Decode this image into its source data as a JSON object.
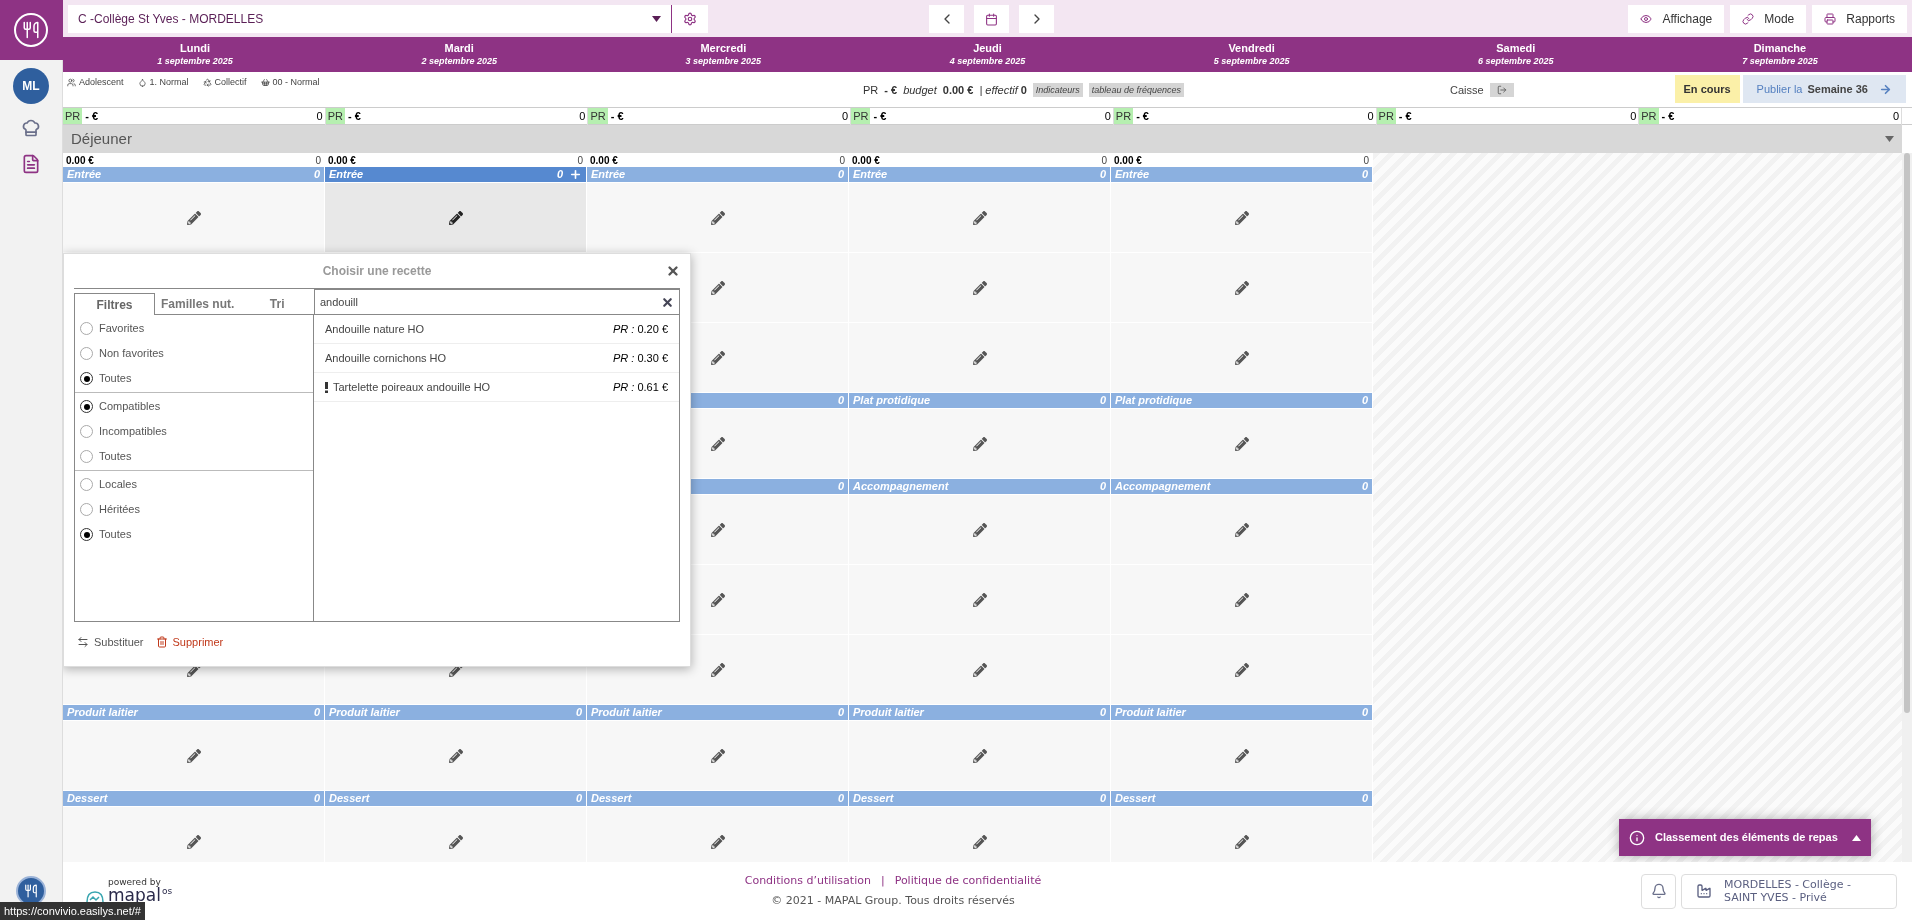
{
  "sidebar": {
    "avatar": "ML"
  },
  "toolbar": {
    "site_select": "C -Collège St Yves - MORDELLES",
    "buttons": [
      {
        "label": "Affichage",
        "kind": "eye"
      },
      {
        "label": "Mode",
        "kind": "link"
      },
      {
        "label": "Rapports",
        "kind": "printer"
      }
    ]
  },
  "days": [
    {
      "name": "Lundi",
      "date": "1 septembre 2025"
    },
    {
      "name": "Mardi",
      "date": "2 septembre 2025"
    },
    {
      "name": "Mercredi",
      "date": "3 septembre 2025"
    },
    {
      "name": "Jeudi",
      "date": "4 septembre 2025"
    },
    {
      "name": "Vendredi",
      "date": "5 septembre 2025"
    },
    {
      "name": "Samedi",
      "date": "6 septembre 2025"
    },
    {
      "name": "Dimanche",
      "date": "7 septembre 2025"
    }
  ],
  "info": {
    "tags": [
      {
        "label": "Adolescent",
        "kind": "people"
      },
      {
        "label": "1. Normal",
        "kind": "drop"
      },
      {
        "label": "Collectif",
        "kind": "recycle"
      },
      {
        "label": "00 - Normal",
        "kind": "basket"
      }
    ],
    "pr_label": "PR",
    "pr_value": "- €",
    "budget_label": "budget",
    "budget_value": "0.00 €",
    "effectif_label": "| effectif",
    "effectif_value": "0",
    "chips": [
      "Indicateurs",
      "tableau de fréquences"
    ],
    "caisse": "Caisse",
    "status": "En cours",
    "publish_prefix": "Publier la",
    "publish_week": "Semaine 36"
  },
  "pr_row": [
    {
      "label": "PR",
      "value": "- €",
      "count": "0"
    },
    {
      "label": "PR",
      "value": "- €",
      "count": "0"
    },
    {
      "label": "PR",
      "value": "- €",
      "count": "0"
    },
    {
      "label": "PR",
      "value": "- €",
      "count": "0"
    },
    {
      "label": "PR",
      "value": "- €",
      "count": "0"
    },
    {
      "label": "PR",
      "value": "- €",
      "count": "0"
    },
    {
      "label": "PR",
      "value": "- €",
      "count": "0"
    }
  ],
  "meal": {
    "title": "Déjeuner",
    "columns": [
      {
        "amount": "0.00 €",
        "count": "0",
        "sections": [
          {
            "kind": "starter",
            "label": "Entrée",
            "count": "0",
            "selected": false
          },
          {
            "kind": "dairy",
            "label": "Produit laitier",
            "count": "0",
            "selected": false
          },
          {
            "kind": "dessert",
            "label": "Dessert",
            "count": "0",
            "selected": false
          }
        ]
      },
      {
        "amount": "0.00 €",
        "count": "0",
        "sections": [
          {
            "kind": "starter",
            "label": "Entrée",
            "count": "0",
            "selected": true
          },
          {
            "kind": "dairy",
            "label": "Produit laitier",
            "count": "0",
            "selected": false
          },
          {
            "kind": "dessert",
            "label": "Dessert",
            "count": "0",
            "selected": false
          }
        ]
      },
      {
        "amount": "0.00 €",
        "count": "0",
        "sections": [
          {
            "kind": "starter",
            "label": "Entrée",
            "count": "0",
            "selected": false
          },
          {
            "kind": "main",
            "count": "0",
            "selected": false
          },
          {
            "kind": "side",
            "count": "0",
            "selected": false
          },
          {
            "kind": "dairy",
            "label": "Produit laitier",
            "count": "0",
            "selected": false
          },
          {
            "kind": "dessert",
            "label": "Dessert",
            "count": "0",
            "selected": false
          }
        ]
      },
      {
        "amount": "0.00 €",
        "count": "0",
        "sections": [
          {
            "kind": "starter",
            "label": "Entrée",
            "count": "0",
            "selected": false
          },
          {
            "kind": "main",
            "label": "Plat protidique",
            "count": "0",
            "selected": false
          },
          {
            "kind": "side",
            "label": "Accompagnement",
            "count": "0",
            "selected": false
          },
          {
            "kind": "dairy",
            "label": "Produit laitier",
            "count": "0",
            "selected": false
          },
          {
            "kind": "dessert",
            "label": "Dessert",
            "count": "0",
            "selected": false
          }
        ]
      },
      {
        "amount": "0.00 €",
        "count": "0",
        "sections": [
          {
            "kind": "starter",
            "label": "Entrée",
            "count": "0",
            "selected": false
          },
          {
            "kind": "main",
            "label": "Plat protidique",
            "count": "0",
            "selected": false
          },
          {
            "kind": "side",
            "label": "Accompagnement",
            "count": "0",
            "selected": false
          },
          {
            "kind": "dairy",
            "label": "Produit laitier",
            "count": "0",
            "selected": false
          },
          {
            "kind": "dessert",
            "label": "Dessert",
            "count": "0",
            "selected": false
          }
        ]
      }
    ]
  },
  "recipe_dialog": {
    "title": "Choisir une recette",
    "tabs": [
      {
        "label": "Filtres",
        "selected": true
      },
      {
        "label": "Familles nut.",
        "selected": false
      },
      {
        "label": "Tri",
        "selected": false
      }
    ],
    "filter_groups": [
      [
        {
          "label": "Favorites",
          "selected": false
        },
        {
          "label": "Non favorites",
          "selected": false
        },
        {
          "label": "Toutes",
          "selected": true
        }
      ],
      [
        {
          "label": "Compatibles",
          "selected": true
        },
        {
          "label": "Incompatibles",
          "selected": false
        },
        {
          "label": "Toutes",
          "selected": false
        }
      ],
      [
        {
          "label": "Locales",
          "selected": false
        },
        {
          "label": "Héritées",
          "selected": false
        },
        {
          "label": "Toutes",
          "selected": true
        }
      ]
    ],
    "search": {
      "value": "andouill"
    },
    "results": [
      {
        "name": "Andouille nature HO",
        "price": "*PR :* 0.20 €",
        "warning": false
      },
      {
        "name": "Andouille cornichons HO",
        "price": "*PR :* 0.30 €",
        "warning": false
      },
      {
        "name": "Tartelette poireaux andouille HO",
        "price": "*PR :* 0.61 €",
        "warning": true
      }
    ],
    "actions": [
      {
        "label": "Substituer",
        "kind": "swap"
      },
      {
        "label": "Supprimer",
        "kind": "delete"
      }
    ]
  },
  "notification": {
    "title": "Classement des éléments de repas"
  },
  "footer": {
    "brand_tagline": "powered by",
    "brand_name": "mapal",
    "brand_suffix": "os",
    "links": [
      "Conditions d’utilisation",
      "Politique de confidentialité"
    ],
    "separator": "|",
    "copyright": "© 2021 - MAPAL Group. Tous droits réservés",
    "site_line1": "MORDELLES - Collège -",
    "site_line2": "SAINT YVES - Privé"
  },
  "status_bar": {
    "url": "https://convivio.easilys.net/#"
  }
}
